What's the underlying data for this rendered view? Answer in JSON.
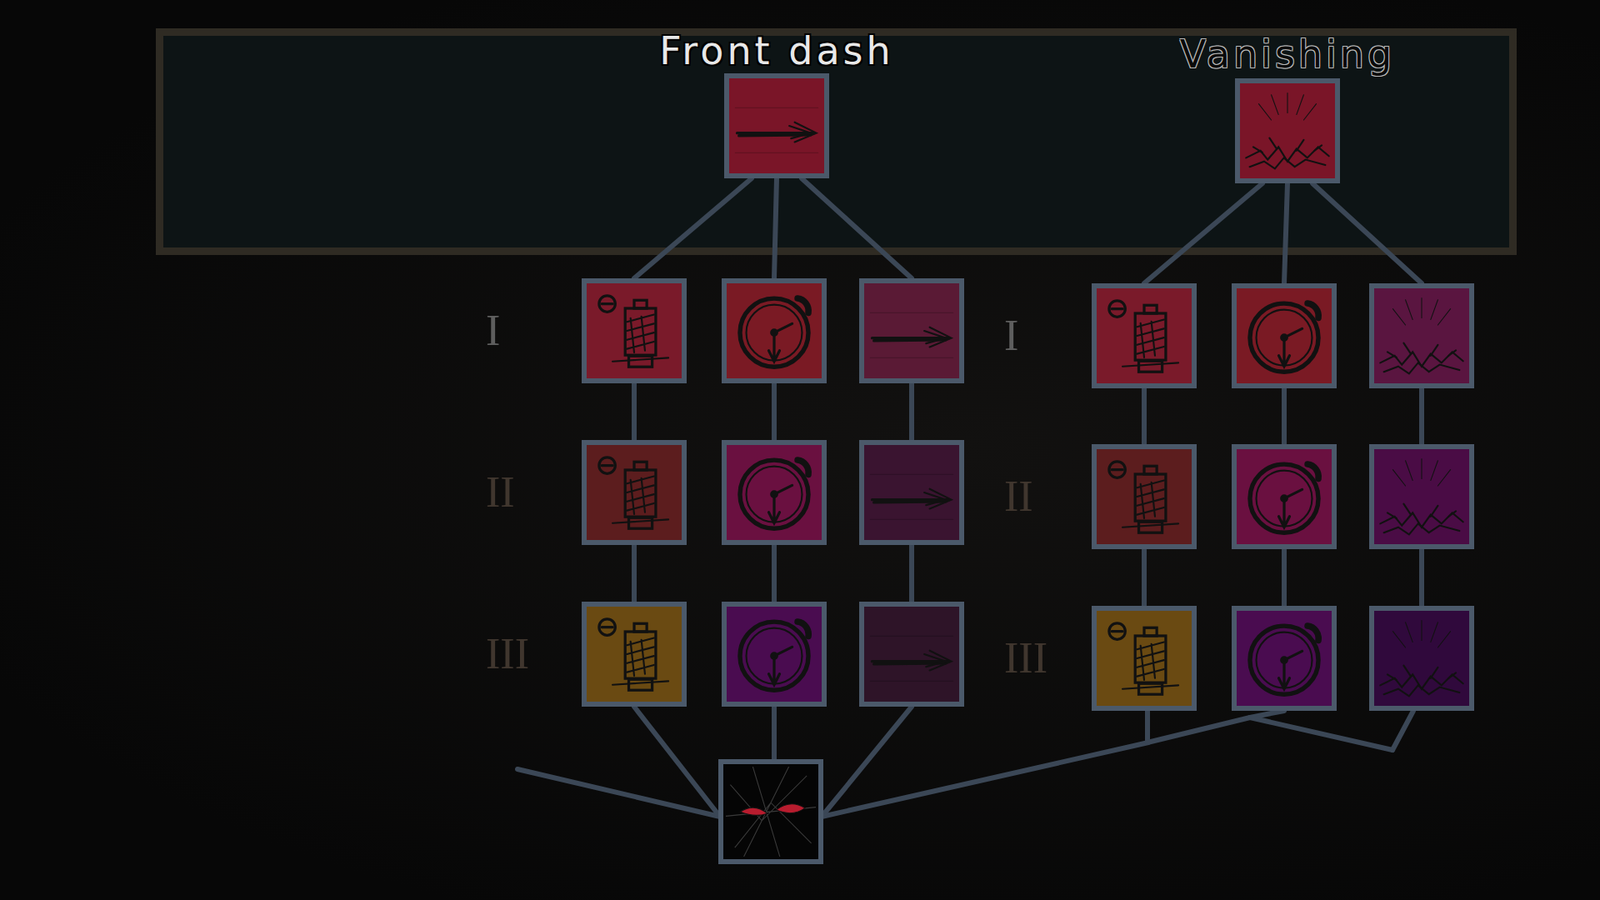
{
  "trees": [
    {
      "title": "Front dash",
      "kind": "dash",
      "root_color": "#7a1528",
      "tiers": [
        {
          "label": "I",
          "unlocked": true
        },
        {
          "label": "II",
          "unlocked": false
        },
        {
          "label": "III",
          "unlocked": false
        }
      ],
      "branches": [
        {
          "kind": "cost",
          "colors": [
            "#7a1a2a",
            "#5c1d1e",
            "#6a4a12"
          ]
        },
        {
          "kind": "cooldown",
          "colors": [
            "#7a1a24",
            "#6a1040",
            "#4a0c50"
          ]
        },
        {
          "kind": "dash",
          "colors": [
            "#5a1a35",
            "#3a1430",
            "#2e1428"
          ]
        }
      ]
    },
    {
      "title": "Vanishing",
      "kind": "vanish",
      "root_color": "#7a1528",
      "tiers": [
        {
          "label": "I",
          "unlocked": true
        },
        {
          "label": "II",
          "unlocked": false
        },
        {
          "label": "III",
          "unlocked": false
        }
      ],
      "branches": [
        {
          "kind": "cost",
          "colors": [
            "#7a1a2a",
            "#5c1d1e",
            "#6a4a12"
          ]
        },
        {
          "kind": "cooldown",
          "colors": [
            "#7a1a24",
            "#6a1040",
            "#4a0c50"
          ]
        },
        {
          "kind": "vanish",
          "colors": [
            "#5a1540",
            "#4a0c45",
            "#30093c"
          ]
        }
      ]
    }
  ],
  "final_node": {
    "kind": "eyes",
    "color": "#050505"
  }
}
